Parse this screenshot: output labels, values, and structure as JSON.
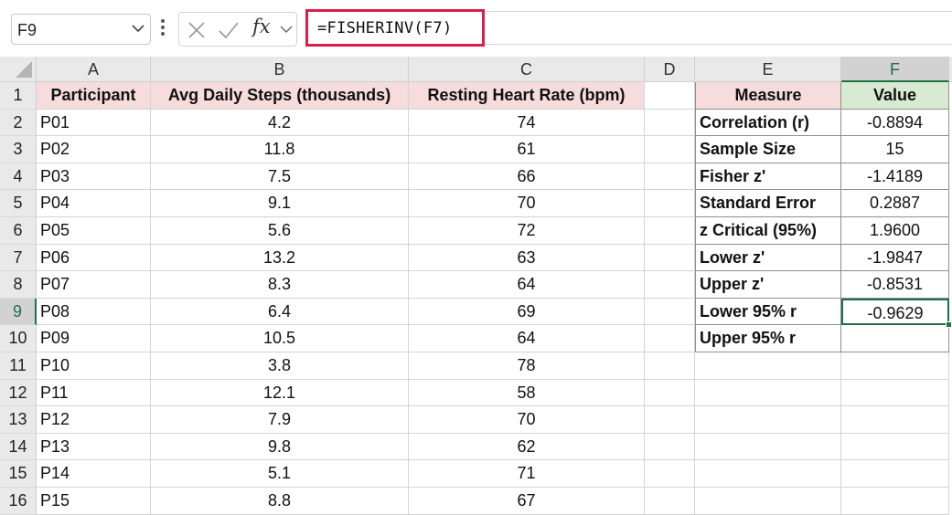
{
  "formula_bar": {
    "name_box": "F9",
    "formula": "=FISHERINV(F7)",
    "fx_label": "fx"
  },
  "columns": [
    "A",
    "B",
    "C",
    "D",
    "E",
    "F"
  ],
  "rows": [
    "1",
    "2",
    "3",
    "4",
    "5",
    "6",
    "7",
    "8",
    "9",
    "10",
    "11",
    "12",
    "13",
    "14",
    "15",
    "16"
  ],
  "table": {
    "headers": [
      "Participant",
      "Avg Daily Steps (thousands)",
      "Resting Heart Rate (bpm)"
    ],
    "rows": [
      [
        "P01",
        "4.2",
        "74"
      ],
      [
        "P02",
        "11.8",
        "61"
      ],
      [
        "P03",
        "7.5",
        "66"
      ],
      [
        "P04",
        "9.1",
        "70"
      ],
      [
        "P05",
        "5.6",
        "72"
      ],
      [
        "P06",
        "13.2",
        "63"
      ],
      [
        "P07",
        "8.3",
        "64"
      ],
      [
        "P08",
        "6.4",
        "69"
      ],
      [
        "P09",
        "10.5",
        "64"
      ],
      [
        "P10",
        "3.8",
        "78"
      ],
      [
        "P11",
        "12.1",
        "58"
      ],
      [
        "P12",
        "7.9",
        "70"
      ],
      [
        "P13",
        "9.8",
        "62"
      ],
      [
        "P14",
        "5.1",
        "71"
      ],
      [
        "P15",
        "8.8",
        "67"
      ]
    ]
  },
  "stats": {
    "headers": [
      "Measure",
      "Value"
    ],
    "rows": [
      [
        "Correlation (r)",
        "-0.8894"
      ],
      [
        "Sample Size",
        "15"
      ],
      [
        "Fisher z'",
        "-1.4189"
      ],
      [
        "Standard Error",
        "0.2887"
      ],
      [
        "z Critical (95%)",
        "1.9600"
      ],
      [
        "Lower z'",
        "-1.9847"
      ],
      [
        "Upper z'",
        "-0.8531"
      ],
      [
        "Lower 95% r",
        "-0.9629"
      ],
      [
        "Upper 95% r",
        ""
      ]
    ]
  },
  "colors": {
    "header_pink": "#f6dcdc",
    "header_green": "#d9ead3",
    "selection_green": "#1e7145",
    "formula_highlight": "#d81e4a"
  },
  "active_cell": "F9"
}
